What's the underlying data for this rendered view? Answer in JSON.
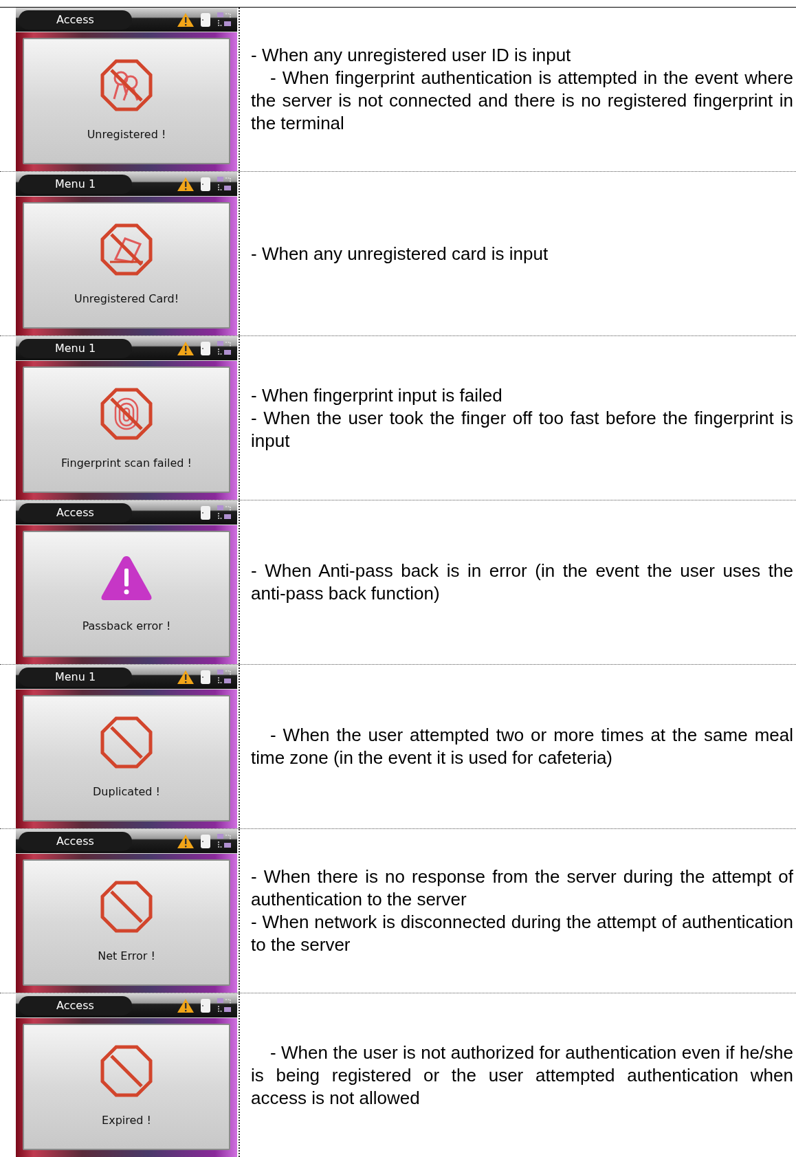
{
  "rows": [
    {
      "screen": {
        "title": "Access",
        "warning": true,
        "kind": "unregistered-user",
        "message": "Unregistered !"
      },
      "description": [
        {
          "text": "- When any unregistered user ID is input",
          "indent": false
        },
        {
          "text": "- When fingerprint authentication is attempted in the event where the server is not connected and there is no registered fingerprint in the terminal",
          "indent": true
        }
      ]
    },
    {
      "screen": {
        "title": "Menu 1",
        "warning": true,
        "kind": "unregistered-card",
        "message": "Unregistered Card!"
      },
      "description": [
        {
          "text": "- When any unregistered card is input",
          "indent": false
        }
      ]
    },
    {
      "screen": {
        "title": "Menu 1",
        "warning": true,
        "kind": "fingerprint",
        "message": "Fingerprint scan failed !"
      },
      "description": [
        {
          "text": "- When fingerprint input is failed",
          "indent": false
        },
        {
          "text": "- When the user took the finger off too fast before the fingerprint is input",
          "indent": false
        }
      ]
    },
    {
      "screen": {
        "title": "Access",
        "warning": false,
        "kind": "passback",
        "message": "Passback error !"
      },
      "description": [
        {
          "text": "- When Anti-pass back is in error (in the event the user uses the anti-pass back function)",
          "indent": false
        }
      ]
    },
    {
      "screen": {
        "title": "Menu 1",
        "warning": true,
        "kind": "prohibited",
        "message": "Duplicated !"
      },
      "description": [
        {
          "text": "- When the user attempted two or more times at the same meal time zone (in the event it is used for cafeteria)",
          "indent": true
        }
      ]
    },
    {
      "screen": {
        "title": "Access",
        "warning": true,
        "kind": "prohibited",
        "message": "Net Error !"
      },
      "description": [
        {
          "text": "- When there is no response from the server during the attempt of authentication to the server",
          "indent": false
        },
        {
          "text": "- When network is disconnected during the attempt of authentication to the server",
          "indent": false
        }
      ]
    },
    {
      "screen": {
        "title": "Access",
        "warning": true,
        "kind": "prohibited",
        "message": "Expired !"
      },
      "description": [
        {
          "text": "- When the user is not authorized for authentication even if he/she is being registered or the user attempted authentication when access is not allowed",
          "indent": true
        }
      ]
    }
  ]
}
